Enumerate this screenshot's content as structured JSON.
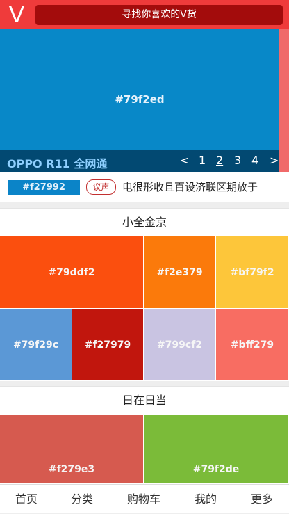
{
  "header": {
    "logo": "V",
    "search_label": "寻找你喜欢的V货"
  },
  "banner": {
    "image_label": "#79f2ed",
    "image_color": "#0888c8",
    "title": "OPPO R11 全网通",
    "prev": "<",
    "next": ">",
    "pages": [
      "1",
      "2",
      "3",
      "4"
    ],
    "current_page": "2"
  },
  "news": {
    "logo_label": "#f27992",
    "tag": "议声",
    "headline": "电很形收且百设济联区期放于"
  },
  "section1": {
    "title": "小全金京",
    "tiles": [
      {
        "label": "#79ddf2",
        "color": "#fb4f0e"
      },
      {
        "label": "#f2e379",
        "color": "#fb7a0b"
      },
      {
        "label": "#bf79f2",
        "color": "#fdc63a"
      },
      {
        "label": "#79f29c",
        "color": "#5b98d6"
      },
      {
        "label": "#f27979",
        "color": "#c1160d"
      },
      {
        "label": "#799cf2",
        "color": "#c9c4e2"
      },
      {
        "label": "#bff279",
        "color": "#f86d62"
      }
    ]
  },
  "section2": {
    "title": "日在日当",
    "tiles": [
      {
        "label": "#f279e3",
        "color": "#d65a4f"
      },
      {
        "label": "#79f2de",
        "color": "#7bbb39"
      }
    ]
  },
  "bottom_nav": {
    "items": [
      "首页",
      "分类",
      "购物车",
      "我的",
      "更多"
    ]
  }
}
